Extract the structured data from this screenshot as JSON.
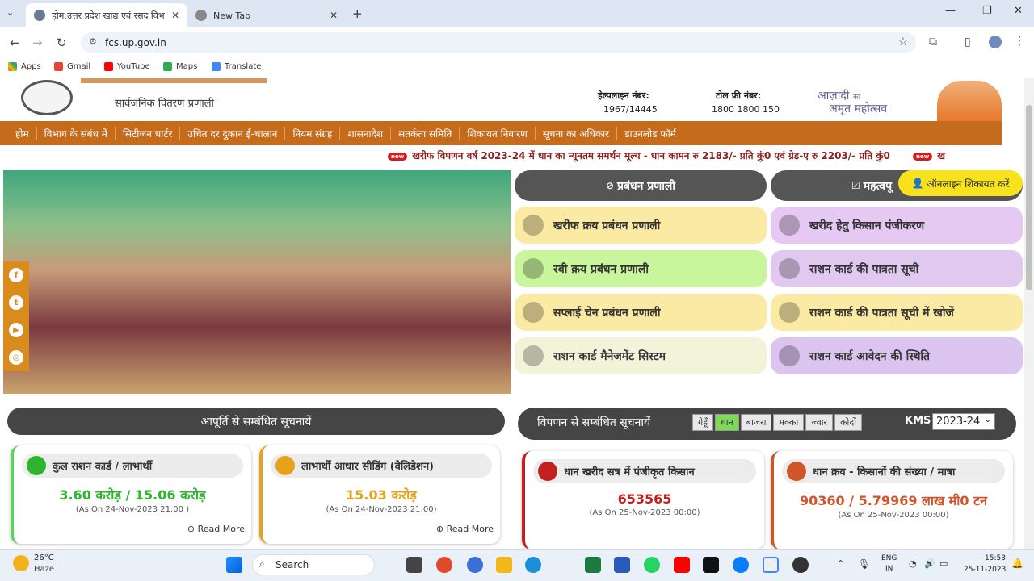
{
  "browser": {
    "tabs": [
      {
        "title": "होम:उत्तर प्रदेश खाद्य एवं रसद विभा",
        "active": true
      },
      {
        "title": "New Tab",
        "active": false
      }
    ],
    "url": "fcs.up.gov.in",
    "bookmarks": [
      "Apps",
      "Gmail",
      "YouTube",
      "Maps",
      "Translate"
    ]
  },
  "header": {
    "subtitle": "सार्वजनिक वितरण प्रणाली",
    "helpline_label": "हेल्पलाइन नंबर:",
    "helpline_value": "1967/14445",
    "tollfree_label": "टोल फ्री नंबर:",
    "tollfree_value": "1800 1800 150",
    "azadi_line1": "आज़ादी",
    "azadi_ka": "का",
    "azadi_line2": "अमृत महोत्सव"
  },
  "nav": [
    "होम",
    "विभाग के संबंध में",
    "सिटीजन चार्टर",
    "उचित दर दुकान ई-चालान",
    "नियम संग्रह",
    "शासनादेश",
    "सतर्कता समिति",
    "शिकायत निवारण",
    "सूचना का अधिकार",
    "डाउनलोड फॉर्म"
  ],
  "ticker": {
    "badge": "new",
    "text": "खरीफ विपणन वर्ष 2023-24 में धान का न्यूनतम समर्थन मूल्य - धान कामन रु 2183/- प्रति कुं0 एवं ग्रेड-ए रु 2203/- प्रति कुं0",
    "tail": "ख"
  },
  "management": {
    "title": "प्रबंधन प्रणाली",
    "items": [
      {
        "label": "खरीफ क्रय प्रबंधन प्रणाली",
        "color": "#fbeaa4"
      },
      {
        "label": "रबी क्रय प्रबंधन प्रणाली",
        "color": "#c9f59d"
      },
      {
        "label": "सप्लाई चेन प्रबंधन प्रणाली",
        "color": "#fbeaa4"
      },
      {
        "label": "राशन कार्ड मैनेजमेंट सिस्टम",
        "color": "#f3f3d9"
      }
    ]
  },
  "important": {
    "title": "महत्वपू",
    "complaint_button": "ऑनलाइन शिकायत करें",
    "items": [
      {
        "label": "खरीद हेतु किसान पंजीकरण",
        "color": "#e5c9f2"
      },
      {
        "label": "राशन कार्ड की पात्रता सूची",
        "color": "#e0c8ee"
      },
      {
        "label": "राशन कार्ड की पात्रता सूची में खोजें",
        "color": "#fbeaa4"
      },
      {
        "label": "राशन कार्ड आवेदन की स्थिति",
        "color": "#dcc4f0"
      }
    ]
  },
  "supply": {
    "title": "आपूर्ति से सम्बंधित सूचनायें",
    "cards": [
      {
        "title": "कुल राशन कार्ड / लाभार्थी",
        "value": "3.60 करोड़ / 15.06 करोड़",
        "asof": "(As On 24-Nov-2023 21:00 )",
        "more": "Read More",
        "color": "#2db52d"
      },
      {
        "title": "लाभार्थी आधार सीडिंग (वेलिडेशन)",
        "value": "15.03 करोड़",
        "asof": "(As On 24-Nov-2023 21:00)",
        "more": "Read More",
        "color": "#e6a21a"
      }
    ]
  },
  "marketing": {
    "title": "विपणन से सम्बंधित सूचनायें",
    "crops": [
      "गेहूँ",
      "धान",
      "बाजरा",
      "मक्का",
      "ज्वार",
      "कोदों"
    ],
    "selected_crop": "धान",
    "kms_label": "KMS",
    "kms_value": "2023-24",
    "cards": [
      {
        "title": "धान खरीद सत्र में पंजीकृत किसान",
        "value": "653565",
        "asof": "(As On 25-Nov-2023 00:00)"
      },
      {
        "title": "धान क्रय - किसानों की संख्या / मात्रा",
        "value": "90360 / 5.79969 लाख मी0 टन",
        "asof": "(As On 25-Nov-2023 00:00)"
      }
    ]
  },
  "taskbar": {
    "temp": "26°C",
    "weather": "Haze",
    "search": "Search",
    "lang1": "ENG",
    "lang2": "IN",
    "time": "15:53",
    "date": "25-11-2023"
  }
}
